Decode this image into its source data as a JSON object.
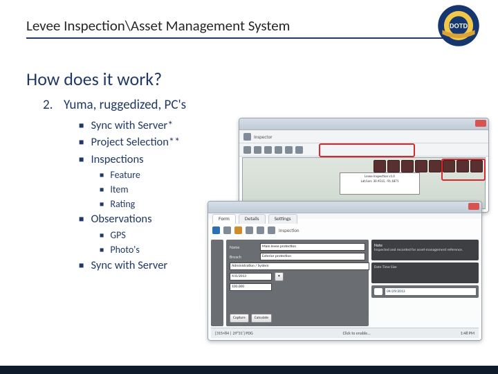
{
  "title": "Levee Inspection\\Asset Management System",
  "section_title": "How does it work?",
  "logo": {
    "outer_text": "LOUISIANA'S ON THE MOVE",
    "inner_text": "DOTD",
    "banner_text": "BUILDS THE WAY"
  },
  "list": {
    "number": "2.",
    "heading": "Yuma, ruggedized, PC's",
    "items": [
      {
        "label": "Sync with Server*"
      },
      {
        "label": "Project Selection**"
      },
      {
        "label": "Inspections",
        "children": [
          "Feature",
          "Item",
          "Rating"
        ]
      },
      {
        "label": "Observations",
        "children": [
          "GPS",
          "Photo's"
        ]
      },
      {
        "label": "Sync with Server"
      }
    ]
  },
  "screenshot_a": {
    "window_title": "Inspector",
    "info_lines": [
      "Levee Inspection v1.0",
      "Lat/Lon: 30.4515, -91.1871"
    ]
  },
  "screenshot_b": {
    "window_title": "Inspector",
    "tabs": [
      "Form",
      "Details",
      "Settings"
    ],
    "header_label": "Inspection",
    "form": {
      "name_label": "Name",
      "name_value": "Main levee protection",
      "breach_label": "Breach",
      "breach_value": "Exterior protection",
      "admin_label": "Administration / System",
      "date_value": "4/6/2013",
      "rating_value": "100.000",
      "buttons": [
        "Capture",
        "Calculate"
      ]
    },
    "right": {
      "note_label": "Note",
      "note_text": "Inspected and recorded for asset-management reference.",
      "table_headers": "Date      Time      Size",
      "photo_date": "04/29/2013"
    },
    "footer_left": "[315×84 | 29°31'] PDG",
    "footer_center": "Click to enable...",
    "footer_right": "1:48 PM"
  }
}
